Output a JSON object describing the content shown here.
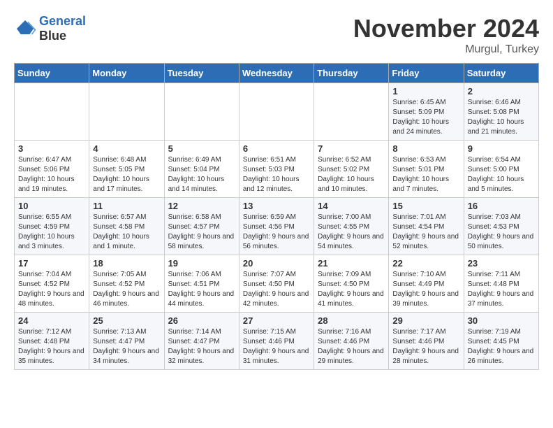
{
  "header": {
    "logo_line1": "General",
    "logo_line2": "Blue",
    "month": "November 2024",
    "location": "Murgul, Turkey"
  },
  "weekdays": [
    "Sunday",
    "Monday",
    "Tuesday",
    "Wednesday",
    "Thursday",
    "Friday",
    "Saturday"
  ],
  "weeks": [
    [
      {
        "day": "",
        "info": ""
      },
      {
        "day": "",
        "info": ""
      },
      {
        "day": "",
        "info": ""
      },
      {
        "day": "",
        "info": ""
      },
      {
        "day": "",
        "info": ""
      },
      {
        "day": "1",
        "info": "Sunrise: 6:45 AM\nSunset: 5:09 PM\nDaylight: 10 hours and 24 minutes."
      },
      {
        "day": "2",
        "info": "Sunrise: 6:46 AM\nSunset: 5:08 PM\nDaylight: 10 hours and 21 minutes."
      }
    ],
    [
      {
        "day": "3",
        "info": "Sunrise: 6:47 AM\nSunset: 5:06 PM\nDaylight: 10 hours and 19 minutes."
      },
      {
        "day": "4",
        "info": "Sunrise: 6:48 AM\nSunset: 5:05 PM\nDaylight: 10 hours and 17 minutes."
      },
      {
        "day": "5",
        "info": "Sunrise: 6:49 AM\nSunset: 5:04 PM\nDaylight: 10 hours and 14 minutes."
      },
      {
        "day": "6",
        "info": "Sunrise: 6:51 AM\nSunset: 5:03 PM\nDaylight: 10 hours and 12 minutes."
      },
      {
        "day": "7",
        "info": "Sunrise: 6:52 AM\nSunset: 5:02 PM\nDaylight: 10 hours and 10 minutes."
      },
      {
        "day": "8",
        "info": "Sunrise: 6:53 AM\nSunset: 5:01 PM\nDaylight: 10 hours and 7 minutes."
      },
      {
        "day": "9",
        "info": "Sunrise: 6:54 AM\nSunset: 5:00 PM\nDaylight: 10 hours and 5 minutes."
      }
    ],
    [
      {
        "day": "10",
        "info": "Sunrise: 6:55 AM\nSunset: 4:59 PM\nDaylight: 10 hours and 3 minutes."
      },
      {
        "day": "11",
        "info": "Sunrise: 6:57 AM\nSunset: 4:58 PM\nDaylight: 10 hours and 1 minute."
      },
      {
        "day": "12",
        "info": "Sunrise: 6:58 AM\nSunset: 4:57 PM\nDaylight: 9 hours and 58 minutes."
      },
      {
        "day": "13",
        "info": "Sunrise: 6:59 AM\nSunset: 4:56 PM\nDaylight: 9 hours and 56 minutes."
      },
      {
        "day": "14",
        "info": "Sunrise: 7:00 AM\nSunset: 4:55 PM\nDaylight: 9 hours and 54 minutes."
      },
      {
        "day": "15",
        "info": "Sunrise: 7:01 AM\nSunset: 4:54 PM\nDaylight: 9 hours and 52 minutes."
      },
      {
        "day": "16",
        "info": "Sunrise: 7:03 AM\nSunset: 4:53 PM\nDaylight: 9 hours and 50 minutes."
      }
    ],
    [
      {
        "day": "17",
        "info": "Sunrise: 7:04 AM\nSunset: 4:52 PM\nDaylight: 9 hours and 48 minutes."
      },
      {
        "day": "18",
        "info": "Sunrise: 7:05 AM\nSunset: 4:52 PM\nDaylight: 9 hours and 46 minutes."
      },
      {
        "day": "19",
        "info": "Sunrise: 7:06 AM\nSunset: 4:51 PM\nDaylight: 9 hours and 44 minutes."
      },
      {
        "day": "20",
        "info": "Sunrise: 7:07 AM\nSunset: 4:50 PM\nDaylight: 9 hours and 42 minutes."
      },
      {
        "day": "21",
        "info": "Sunrise: 7:09 AM\nSunset: 4:50 PM\nDaylight: 9 hours and 41 minutes."
      },
      {
        "day": "22",
        "info": "Sunrise: 7:10 AM\nSunset: 4:49 PM\nDaylight: 9 hours and 39 minutes."
      },
      {
        "day": "23",
        "info": "Sunrise: 7:11 AM\nSunset: 4:48 PM\nDaylight: 9 hours and 37 minutes."
      }
    ],
    [
      {
        "day": "24",
        "info": "Sunrise: 7:12 AM\nSunset: 4:48 PM\nDaylight: 9 hours and 35 minutes."
      },
      {
        "day": "25",
        "info": "Sunrise: 7:13 AM\nSunset: 4:47 PM\nDaylight: 9 hours and 34 minutes."
      },
      {
        "day": "26",
        "info": "Sunrise: 7:14 AM\nSunset: 4:47 PM\nDaylight: 9 hours and 32 minutes."
      },
      {
        "day": "27",
        "info": "Sunrise: 7:15 AM\nSunset: 4:46 PM\nDaylight: 9 hours and 31 minutes."
      },
      {
        "day": "28",
        "info": "Sunrise: 7:16 AM\nSunset: 4:46 PM\nDaylight: 9 hours and 29 minutes."
      },
      {
        "day": "29",
        "info": "Sunrise: 7:17 AM\nSunset: 4:46 PM\nDaylight: 9 hours and 28 minutes."
      },
      {
        "day": "30",
        "info": "Sunrise: 7:19 AM\nSunset: 4:45 PM\nDaylight: 9 hours and 26 minutes."
      }
    ]
  ]
}
